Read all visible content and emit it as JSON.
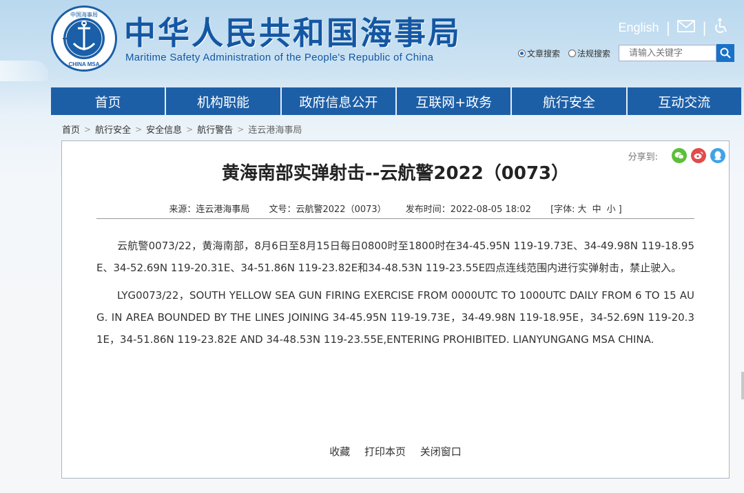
{
  "header": {
    "logo_text": "CHINA MSA",
    "logo_top_text": "中国海事局",
    "title_cn": "中华人民共和国海事局",
    "title_en": "Maritime Safety Administration of the People's Republic of China",
    "english_link": "English",
    "search": {
      "option_1": "文章搜索",
      "option_2": "法规搜索",
      "selected": "文章搜索",
      "placeholder": "请输入关键字"
    }
  },
  "nav": {
    "items": [
      "首页",
      "机构职能",
      "政府信息公开",
      "互联网+政务",
      "航行安全",
      "互动交流"
    ]
  },
  "breadcrumb": [
    "首页",
    "航行安全",
    "安全信息",
    "航行警告",
    "连云港海事局"
  ],
  "article": {
    "share_label": "分享到:",
    "title": "黄海南部实弹射击--云航警2022（0073）",
    "source": "来源：连云港海事局",
    "doc_no": "文号：云航警2022（0073）",
    "publish_time": "发布时间：2022-08-05 18:02",
    "font_label": "[字体:",
    "font_large": "大",
    "font_medium": "中",
    "font_small": "小",
    "font_close": "]",
    "paragraph_cn": "云航警0073/22，黄海南部，8月6日至8月15日每日0800时至1800时在34-45.95N 119-19.73E、34-49.98N 119-18.95E、34-52.69N 119-20.31E、34-51.86N 119-23.82E和34-48.53N 119-23.55E四点连线范围内进行实弹射击，禁止驶入。",
    "paragraph_en": "LYG0073/22，SOUTH YELLOW SEA GUN FIRING EXERCISE FROM 0000UTC TO 1000UTC DAILY FROM 6 TO 15 AUG. IN AREA BOUNDED BY THE LINES JOINING 34-45.95N 119-19.73E，34-49.98N 119-18.95E，34-52.69N 119-20.31E，34-51.86N 119-23.82E AND 34-48.53N 119-23.55E,ENTERING PROHIBITED. LIANYUNGANG MSA CHINA.",
    "action_favorite": "收藏",
    "action_print": "打印本页",
    "action_close": "关闭窗口"
  },
  "colors": {
    "brand_blue": "#1d5fa7",
    "title_blue": "#1457a3",
    "wechat_green": "#5cbf3a",
    "weibo_red": "#e24b4b",
    "qq_blue": "#3fa3e8"
  }
}
